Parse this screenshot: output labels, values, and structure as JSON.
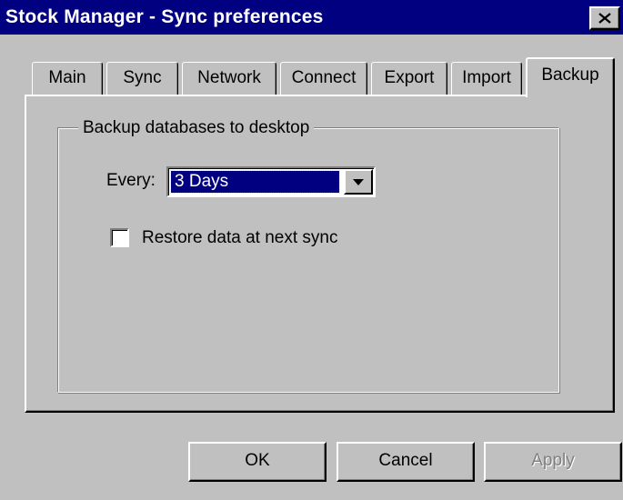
{
  "window": {
    "title": "Stock Manager - Sync preferences",
    "close_icon": "close-icon"
  },
  "tabs": [
    {
      "label": "Main"
    },
    {
      "label": "Sync"
    },
    {
      "label": "Network"
    },
    {
      "label": "Connect"
    },
    {
      "label": "Export"
    },
    {
      "label": "Import"
    },
    {
      "label": "Backup",
      "active": true
    }
  ],
  "backup": {
    "group_label": "Backup databases to desktop",
    "every_label": "Every:",
    "every_value": "3 Days",
    "restore_label": "Restore data at next sync",
    "restore_checked": false
  },
  "buttons": {
    "ok": "OK",
    "cancel": "Cancel",
    "apply": "Apply"
  },
  "colors": {
    "titlebar": "#000080",
    "face": "#c0c0c0",
    "selection": "#000080"
  }
}
